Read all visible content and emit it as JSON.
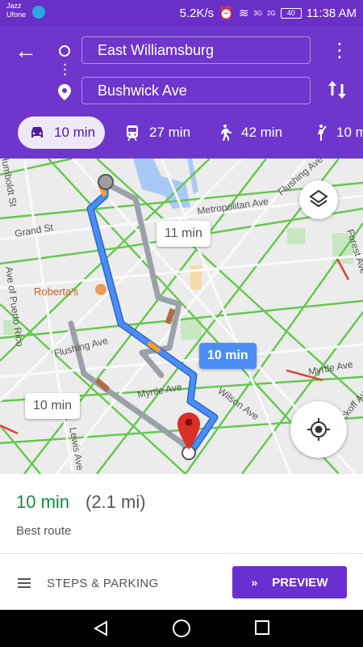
{
  "status_bar": {
    "carrier_1": "Jazz",
    "carrier_2": "Ufone",
    "speed": "5.2K/s",
    "net_1": "3G",
    "net_2": "2G",
    "battery": "40",
    "time": "11:38 AM"
  },
  "directions": {
    "origin": "East Williamsburg",
    "destination": "Bushwick Ave"
  },
  "modes": [
    {
      "label": "10 min",
      "icon": "car-icon",
      "active": true
    },
    {
      "label": "27 min",
      "icon": "train-icon"
    },
    {
      "label": "42 min",
      "icon": "walk-icon"
    },
    {
      "label": "10 m",
      "icon": "rideshare-icon"
    }
  ],
  "map": {
    "labels": {
      "metropolitan": "Metropolitan Ave",
      "grand": "Grand St",
      "flushing_top": "Flushing Ave",
      "flushing_left": "Flushing Ave",
      "myrtle_mid": "Myrtle Ave",
      "myrtle_right": "Myrtle Ave",
      "wilson": "Wilson Ave",
      "wyckoff": "Wyckoff Ave",
      "forest": "Forest Ave",
      "puerto_rico": "Ave of Puerto Rico",
      "humboldt": "Humboldt St",
      "lewis": "Lewis Ave",
      "roberta": "Roberta's"
    },
    "alt_route_1": "11 min",
    "alt_route_2": "10 min",
    "best_route_label": "10 min"
  },
  "sheet": {
    "eta": "10 min",
    "distance": "(2.1 mi)",
    "route_note": "Best route",
    "steps_label": "STEPS & PARKING",
    "preview_label": "PREVIEW"
  },
  "colors": {
    "header": "#6e36cc",
    "route_blue": "#4a8ef5",
    "eta_green": "#0f8f3a",
    "preview_button": "#6a2fd0"
  }
}
